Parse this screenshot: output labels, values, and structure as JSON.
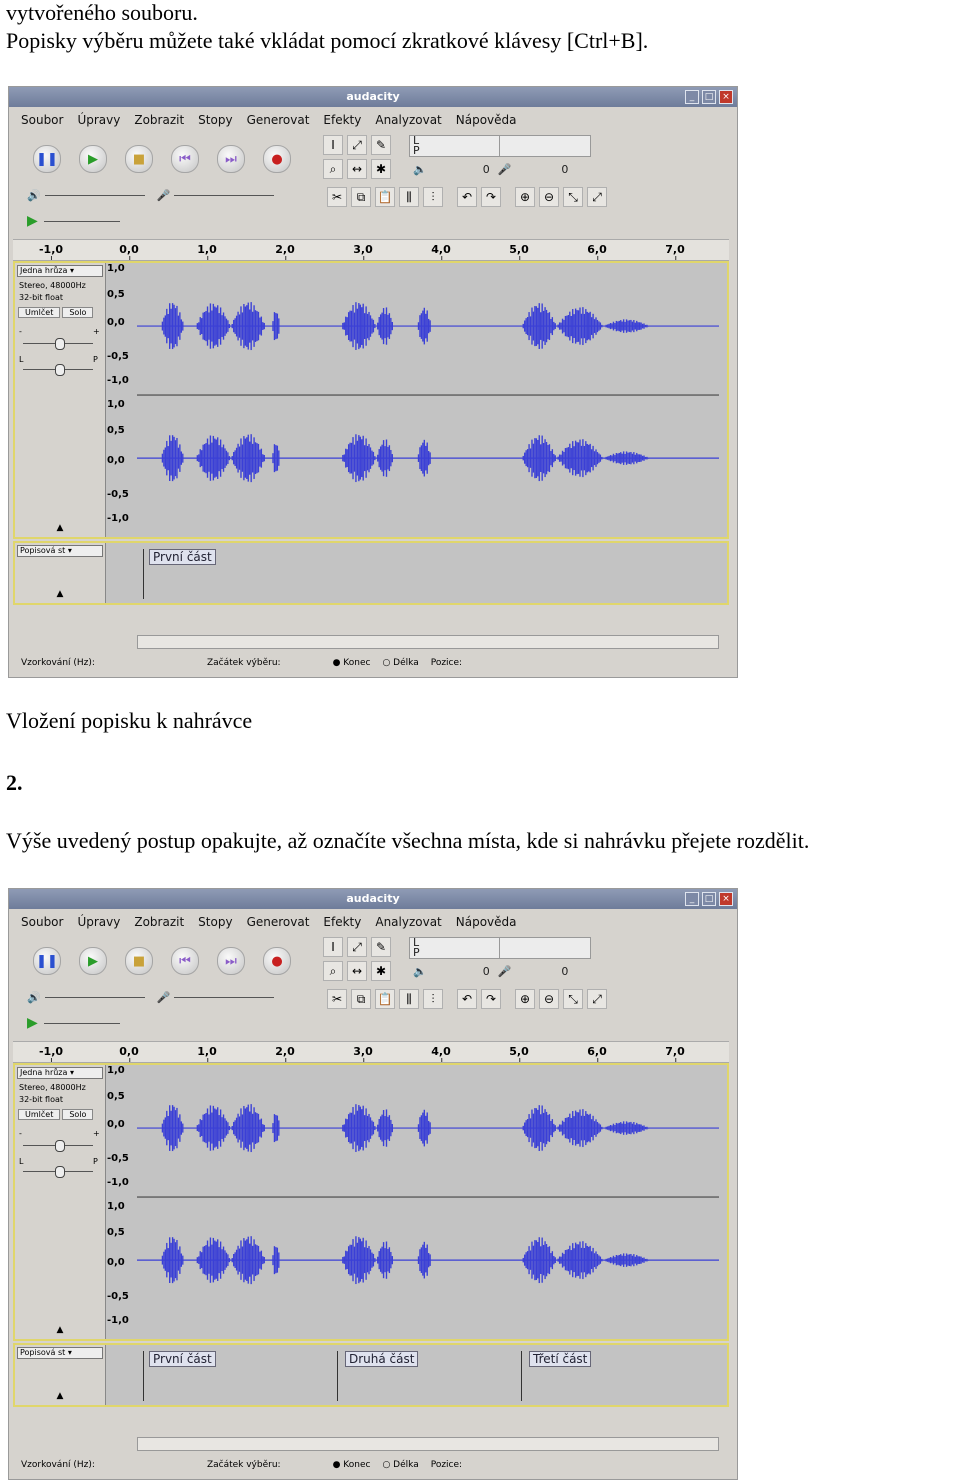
{
  "text_top": {
    "line1": "vytvořeného souboru.",
    "line2": "Popisky výběru můžete také vkládat pomocí zkratkové klávesy [Ctrl+B]."
  },
  "caption1": "Vložení popisku k nahrávce",
  "step_number": "2.",
  "step_text": "Výše uvedený postup opakujte, až označíte všechna místa, kde si nahrávku přejete rozdělit.",
  "app": {
    "title": "audacity",
    "menu": [
      "Soubor",
      "Úpravy",
      "Zobrazit",
      "Stopy",
      "Generovat",
      "Efekty",
      "Analyzovat",
      "Nápověda"
    ],
    "ruler_ticks": [
      "-1,0",
      "0,0",
      "1,0",
      "2,0",
      "3,0",
      "4,0",
      "5,0",
      "6,0",
      "7,0"
    ],
    "meter_l": "L",
    "meter_p": "P",
    "meter_zero": "0",
    "audio_track": {
      "name": "Jedna hrůza",
      "info1": "Stereo, 48000Hz",
      "info2": "32-bit float",
      "mute": "Umlčet",
      "solo": "Solo",
      "gain_minus": "-",
      "gain_plus": "+",
      "pan_l": "L",
      "pan_p": "P",
      "scale": [
        "1,0",
        "0,5",
        "0,0",
        "-0,5",
        "-1,0"
      ]
    },
    "label_track": {
      "name": "Popisová st"
    },
    "status": {
      "rate": "Vzorkování (Hz):",
      "sel_start": "Začátek výběru:",
      "end": "Konec",
      "length": "Délka",
      "position": "Pozice:"
    }
  },
  "screenshot1": {
    "labels": [
      "První část"
    ]
  },
  "screenshot2": {
    "labels": [
      "První část",
      "Druhá část",
      "Třetí část"
    ]
  },
  "colors": {
    "wave": "#3a3fd6",
    "track_border": "#e0d66b",
    "track_bg": "#c3c3c3"
  }
}
